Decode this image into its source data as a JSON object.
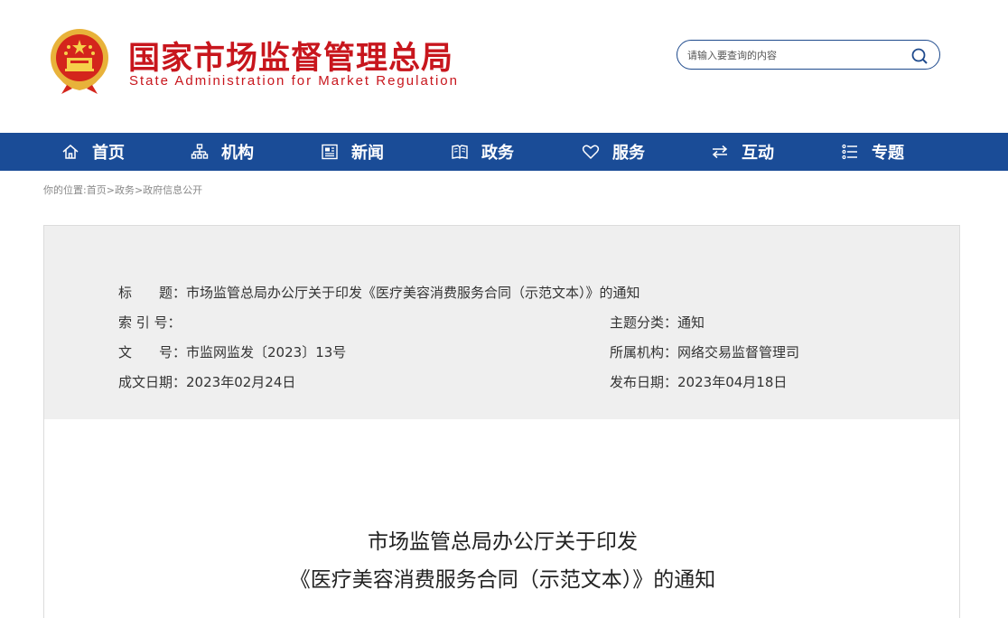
{
  "site": {
    "name_cn": "国家市场监督管理总局",
    "name_en": "State Administration for Market Regulation"
  },
  "search": {
    "placeholder": "请输入要查询的内容",
    "icon": "search-icon"
  },
  "nav": [
    {
      "label": "首页",
      "icon": "home-icon"
    },
    {
      "label": "机构",
      "icon": "org-chart-icon"
    },
    {
      "label": "新闻",
      "icon": "newspaper-icon"
    },
    {
      "label": "政务",
      "icon": "book-icon"
    },
    {
      "label": "服务",
      "icon": "heart-icon"
    },
    {
      "label": "互动",
      "icon": "exchange-arrows-icon"
    },
    {
      "label": "专题",
      "icon": "list-icon"
    }
  ],
  "breadcrumb": {
    "prefix": "你的位置:",
    "items": [
      "首页",
      "政务",
      "政府信息公开"
    ],
    "separator": ">"
  },
  "info": {
    "title_label": "标　　题：",
    "title_value": "市场监管总局办公厅关于印发《医疗美容消费服务合同（示范文本）》的通知",
    "index_label": "索 引 号：",
    "index_value": "",
    "topic_label": "主题分类：",
    "topic_value": "通知",
    "docno_label": "文　　号：",
    "docno_value": "市监网监发〔2023〕13号",
    "dept_label": "所属机构：",
    "dept_value": "网络交易监督管理司",
    "created_label": "成文日期：",
    "created_value": "2023年02月24日",
    "published_label": "发布日期：",
    "published_value": "2023年04月18日"
  },
  "article": {
    "title_line1": "市场监管总局办公厅关于印发",
    "title_line2": "《医疗美容消费服务合同（示范文本）》的通知"
  },
  "colors": {
    "brand_red": "#c8161d",
    "nav_blue": "#1a4c97",
    "info_bg": "#efefef"
  }
}
